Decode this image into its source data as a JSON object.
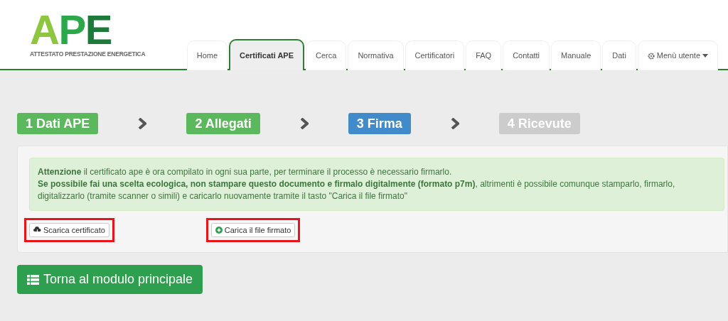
{
  "logo": {
    "title": "APE",
    "subtitle": "ATTESTATO PRESTAZIONE ENERGETICA"
  },
  "tabs": [
    {
      "label": "Home",
      "selected": false
    },
    {
      "label": "Certificati APE",
      "selected": true
    },
    {
      "label": "Cerca",
      "selected": false
    },
    {
      "label": "Normativa",
      "selected": false
    },
    {
      "label": "Certificatori",
      "selected": false
    },
    {
      "label": "FAQ",
      "selected": false
    },
    {
      "label": "Contatti",
      "selected": false
    },
    {
      "label": "Manuale",
      "selected": false
    },
    {
      "label": "Dati",
      "selected": false
    },
    {
      "label": "Menù utente",
      "selected": false,
      "kind": "dropdown"
    }
  ],
  "steps": [
    {
      "label": "1 Dati APE",
      "kind": "done"
    },
    {
      "label": "2 Allegati",
      "kind": "done"
    },
    {
      "label": "3 Firma",
      "kind": "current"
    },
    {
      "label": "4 Ricevute",
      "kind": "pending"
    }
  ],
  "alert": {
    "lines": [
      "**Attenzione** il certificato ape è ora compilato in ogni sua parte, per terminare il processo è necessario firmarlo.",
      "**Se possibile fai una scelta ecologica, non stampare questo documento e firmalo digitalmente (formato p7m)**, altrimenti è possibile comunque stamparlo, firmarlo, digitalizzarlo (tramite scanner o simili) e caricarlo nuovamente tramite il tasto \"Carica il file firmato\""
    ]
  },
  "actions": [
    {
      "label": "Scarica certificato",
      "kind": "download",
      "highlighted": true
    },
    {
      "label": "Carica il file firmato",
      "kind": "upload",
      "highlighted": true
    }
  ],
  "back_button": {
    "label": "Torna al modulo principale"
  }
}
